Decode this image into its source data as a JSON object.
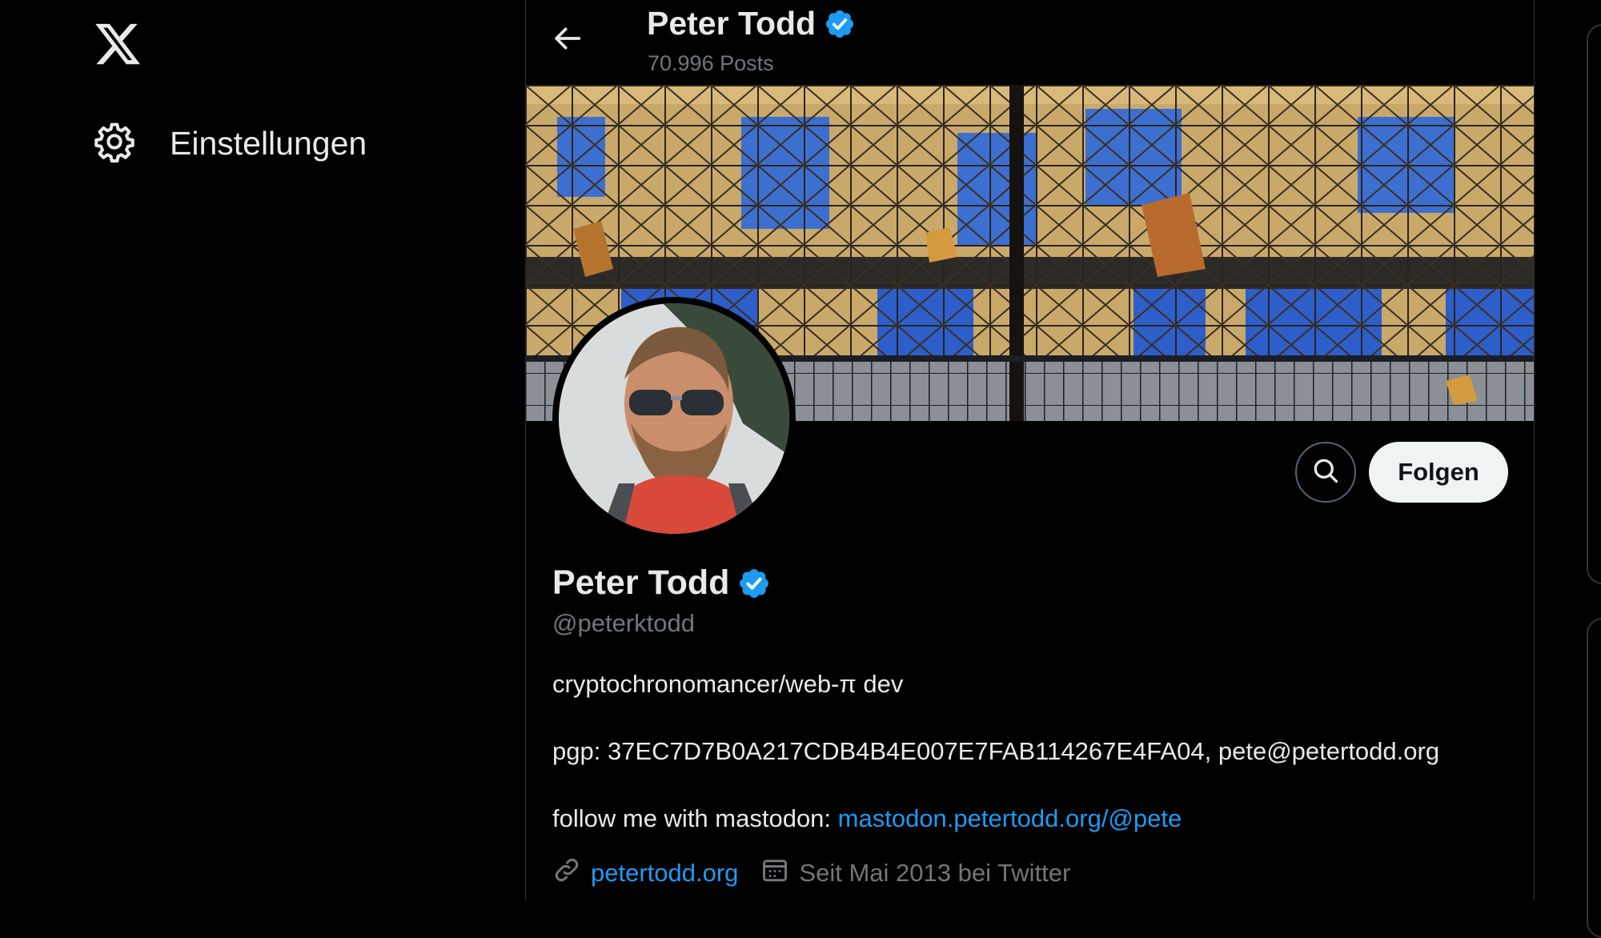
{
  "nav": {
    "logo_icon": "x-logo-icon",
    "settings": {
      "icon": "gear-icon",
      "label": "Einstellungen"
    }
  },
  "header": {
    "back_icon": "arrow-left-icon",
    "name": "Peter Todd",
    "verified_icon": "verified-badge-icon",
    "post_count": "70.996 Posts"
  },
  "profile": {
    "name": "Peter Todd",
    "handle": "@peterktodd",
    "bio": {
      "line1": "cryptochronomancer/web-π dev",
      "line2": "pgp: 37EC7D7B0A217CDB4B4E007E7FAB114267E4FA04, pete@petertodd.org",
      "line3_prefix": "follow me with mastodon: ",
      "line3_link": "mastodon.petertodd.org/@pete"
    },
    "website_icon": "link-icon",
    "website": "petertodd.org",
    "joined_icon": "calendar-icon",
    "joined": "Seit Mai 2013 bei Twitter"
  },
  "actions": {
    "search_icon": "search-icon",
    "follow_label": "Folgen"
  },
  "colors": {
    "background": "#000000",
    "text": "#e7e9ea",
    "secondary_text": "#71767b",
    "link": "#1d9bf0",
    "verified": "#1d9bf0",
    "follow_bg": "#eff3f4"
  }
}
